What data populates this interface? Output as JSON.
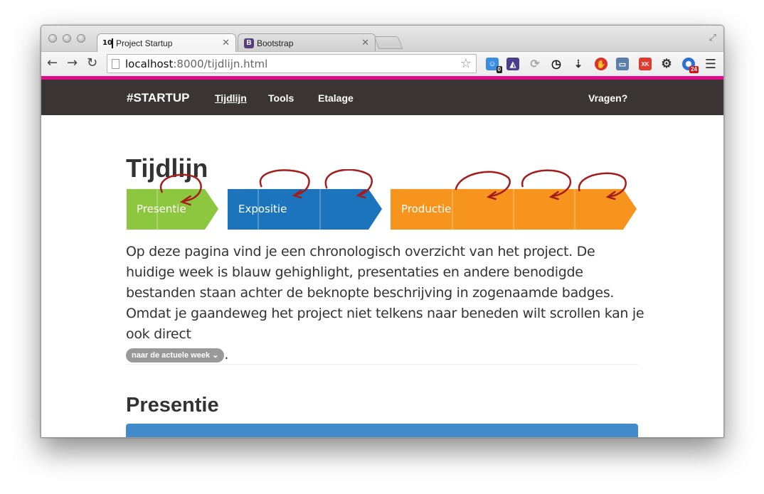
{
  "browser": {
    "tabs": [
      {
        "title": "Project Startup",
        "favicon": "10"
      },
      {
        "title": "Bootstrap",
        "favicon": "B"
      }
    ],
    "url_host": "localhost",
    "url_rest": ":8000/tijdlijn.html",
    "extension_badges": {
      "first": "0",
      "last": "24"
    },
    "accent_color": "#e20a8c"
  },
  "site": {
    "brand": "#STARTUP",
    "nav": [
      "Tijdlijn",
      "Tools",
      "Etalage"
    ],
    "nav_right": "Vragen?",
    "nav_bg": "#3a3532"
  },
  "page": {
    "title": "Tijdlijn",
    "timeline": [
      {
        "label": "Presentie",
        "color": "#8dc63f"
      },
      {
        "label": "Expositie",
        "color": "#1c75bc"
      },
      {
        "label": "Productie",
        "color": "#f7941d"
      }
    ],
    "intro": "Op deze pagina vind je een chronologisch overzicht van het project. De huidige week is blauw gehighlight, presentaties en andere benodigde bestanden staan achter de beknopte beschrijving in zogenaamde badges. Omdat je gaandeweg het project niet telkens naar beneden wilt scrollen kan je ook direct",
    "intro_button": "naar de actuele week",
    "intro_end": ".",
    "section_title": "Presentie"
  }
}
